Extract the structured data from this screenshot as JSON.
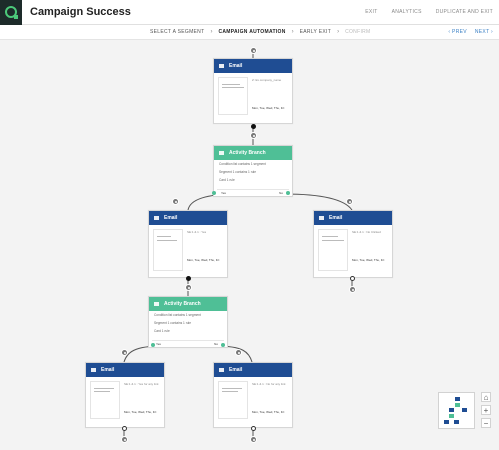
{
  "app": {
    "title": "Campaign Success",
    "accent": "#4cc97a",
    "brand_dark": "#1d2b2a"
  },
  "top_actions": {
    "exit": "EXIT",
    "analytics": "ANALYTICS",
    "duplicate": "DUPLICATE AND EXIT"
  },
  "steps": {
    "s1": "SELECT A SEGMENT",
    "s2": "CAMPAIGN AUTOMATION",
    "s3": "EARLY EXIT",
    "s4": "CONFIRM"
  },
  "nav": {
    "prev": "‹ PREV",
    "next": "NEXT ›"
  },
  "colors": {
    "email_header": "#1f4d93",
    "branch_header": "#4fbf96"
  },
  "nodes": {
    "email1": {
      "title": "Email",
      "meta": "Z: Ex.company_name",
      "days": "Mon, Tue, Wed, Thu, Fri"
    },
    "branch1": {
      "title": "Activity Branch",
      "line1": "Condition list contains 1 segment",
      "line2": "Segment 1 contains 1 rule",
      "line3": "Card 1 rule",
      "yes": "Yes",
      "no": "No"
    },
    "email2": {
      "title": "Email",
      "meta": "SE:1 & 1 : Yes",
      "days": "Mon, Tue, Wed, Thu, Fri"
    },
    "email3": {
      "title": "Email",
      "meta": "SE:1 & 1 : No Clicked",
      "days": "Mon, Tue, Wed, Thu, Fri"
    },
    "branch2": {
      "title": "Activity Branch",
      "line1": "Condition list contains 1 segment",
      "line2": "Segment 1 contains 1 rule",
      "line3": "Card 1 rule",
      "yes": "Yes",
      "no": "No"
    },
    "email4": {
      "title": "Email",
      "meta": "SE:1 & 1 : Yes for any link",
      "days": "Mon, Tue, Wed, Thu, Fri"
    },
    "email5": {
      "title": "Email",
      "meta": "SE:1 & 1 : No for any link",
      "days": "Mon, Tue, Wed, Thu, Fri"
    }
  },
  "icons": {
    "logo": "logo-icon",
    "email": "envelope-icon",
    "branch": "branch-icon",
    "fit": "fit-view-icon"
  },
  "zoom": {
    "fit": "⌂",
    "in": "+",
    "out": "−"
  }
}
